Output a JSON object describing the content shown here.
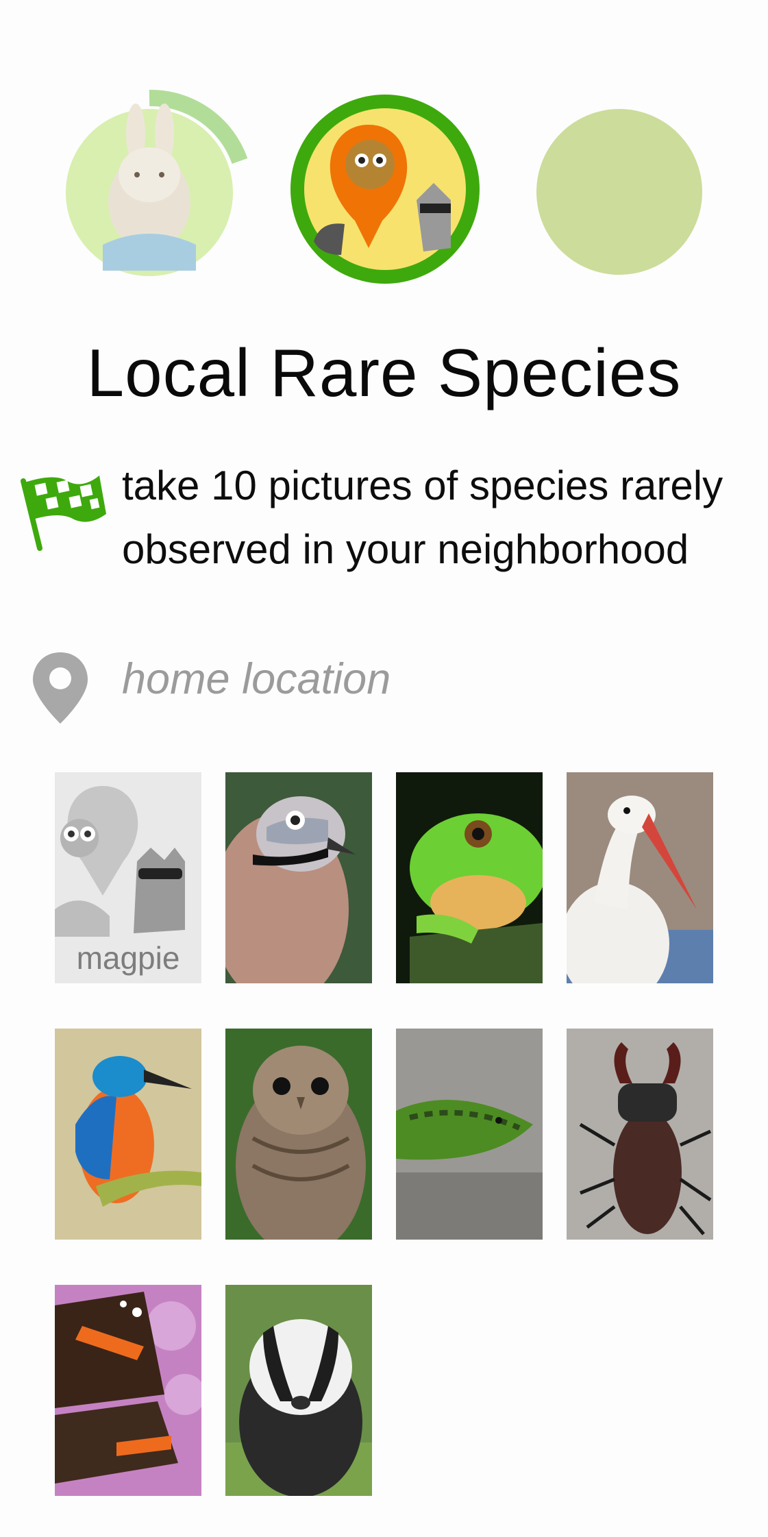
{
  "challenge": {
    "title": "Local Rare Species",
    "goal": "take 10 pictures of species rarely observed in your neighborhood",
    "location": "home location"
  },
  "badges": [
    {
      "name": "rabbit",
      "progress": 0.3,
      "ring_color": "#b2dd99"
    },
    {
      "name": "owl-raccoon",
      "progress": 1.0,
      "ring_color": "#3ea90d"
    },
    {
      "name": "empty",
      "progress": 0,
      "fill_color": "#ccdc9a"
    }
  ],
  "tiles": [
    {
      "name": "placeholder",
      "label": "magpie"
    },
    {
      "name": "jay"
    },
    {
      "name": "tree-frog"
    },
    {
      "name": "stork"
    },
    {
      "name": "kingfisher"
    },
    {
      "name": "tawny-owl"
    },
    {
      "name": "lizard"
    },
    {
      "name": "stag-beetle"
    },
    {
      "name": "red-admiral-butterfly"
    },
    {
      "name": "badger"
    }
  ],
  "colors": {
    "accent_green": "#3ea90d",
    "gray_icon": "#a8a8a8"
  }
}
